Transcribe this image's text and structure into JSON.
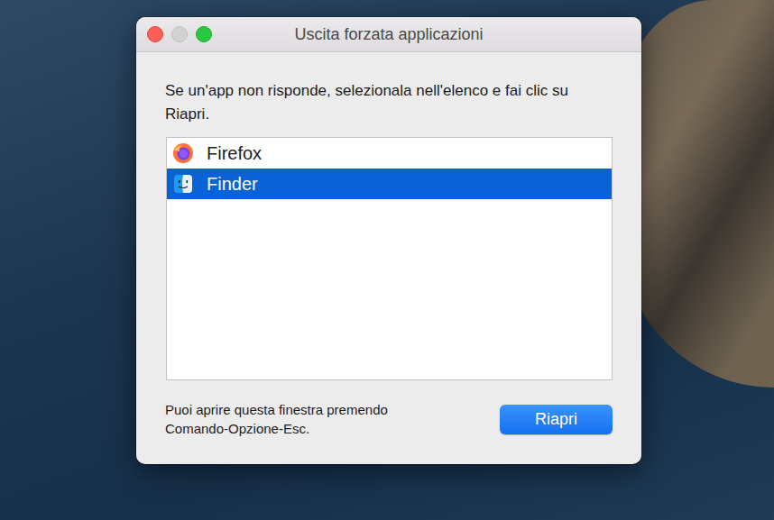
{
  "window": {
    "title": "Uscita forzata applicazioni",
    "controls": [
      {
        "kind": "close",
        "disabled": false
      },
      {
        "kind": "minimize",
        "disabled": true
      },
      {
        "kind": "zoom",
        "disabled": false
      }
    ]
  },
  "instructions": "Se un'app non risponde, selezionala nell'elenco e fai clic su Riapri.",
  "apps": [
    {
      "name": "Firefox",
      "kind": "firefox",
      "selected": false
    },
    {
      "name": "Finder",
      "kind": "finder",
      "selected": true
    }
  ],
  "footer": "Puoi aprire questa finestra premendo Comando-Opzione-Esc.",
  "buttons": [
    "Riapri"
  ]
}
